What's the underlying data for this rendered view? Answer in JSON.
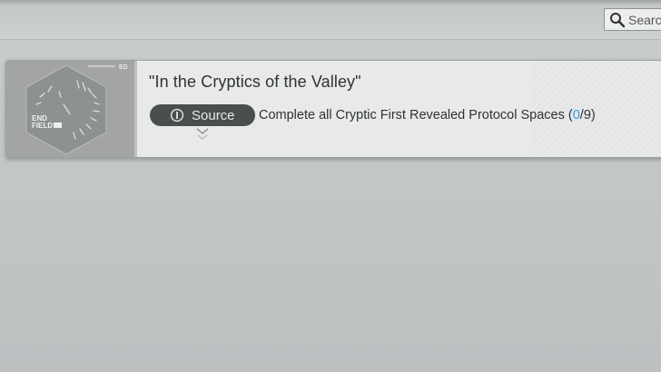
{
  "search": {
    "placeholder": "Search",
    "icon": "magnifier-icon"
  },
  "achievement": {
    "title": "\"In the Cryptics of the Valley\"",
    "source_label": "Source",
    "source_icon": "info-icon",
    "objective_text": "Complete all Cryptic First Revealed Protocol Spaces (",
    "progress_current": "0",
    "progress_total": "/9)",
    "expand_icon": "chevron-down-icon",
    "badge": {
      "logo_lines": [
        "END",
        "FIELD"
      ],
      "corner_tag": "ED"
    }
  },
  "colors": {
    "accent": "#2b9be0",
    "pill": "#4b4e4f",
    "card": "#e8e9e9",
    "background": "#c4c8c8"
  }
}
